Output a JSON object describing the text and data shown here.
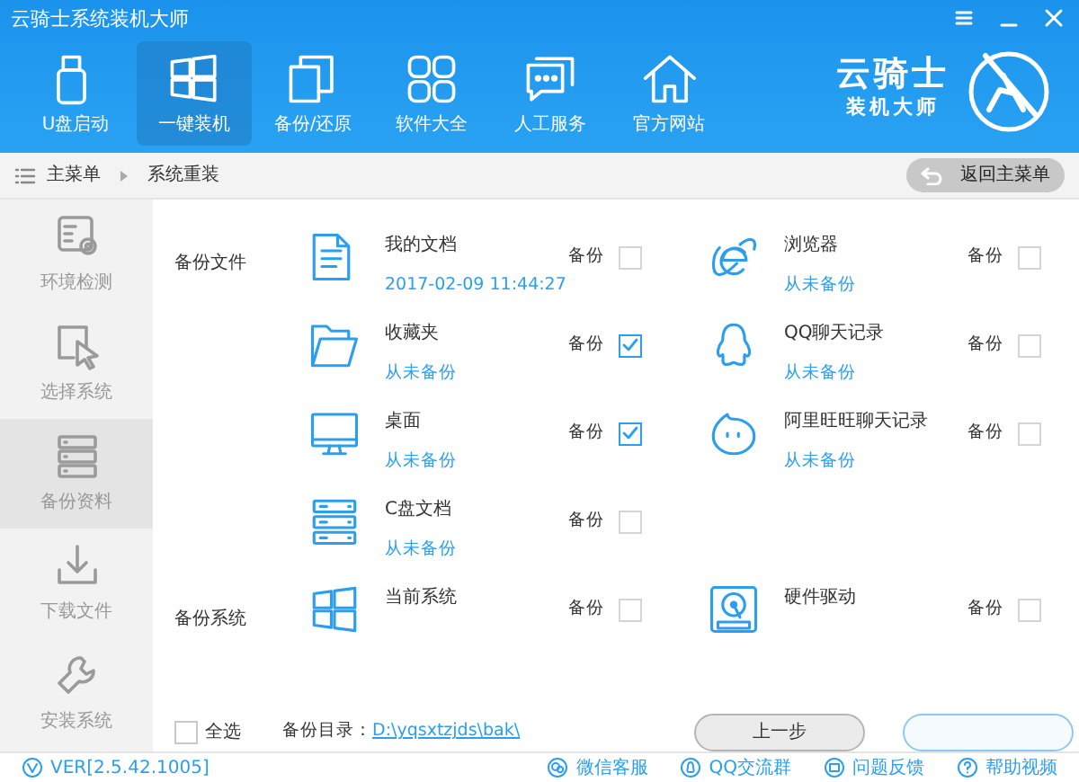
{
  "window": {
    "title": "云骑士系统装机大师"
  },
  "nav": [
    {
      "label": "U盘启动",
      "kind": "usb",
      "selected": false
    },
    {
      "label": "一键装机",
      "kind": "windows",
      "selected": true
    },
    {
      "label": "备份/还原",
      "kind": "copy",
      "selected": false
    },
    {
      "label": "软件大全",
      "kind": "grid",
      "selected": false
    },
    {
      "label": "人工服务",
      "kind": "chat",
      "selected": false
    },
    {
      "label": "官方网站",
      "kind": "home",
      "selected": false
    }
  ],
  "logo": {
    "name": "云骑士",
    "tagline": "装机大师"
  },
  "breadcrumb": [
    "主菜单",
    "系统重装"
  ],
  "back_button": "返回主菜单",
  "sidebar": [
    {
      "label": "环境检测",
      "kind": "gear-box",
      "selected": false
    },
    {
      "label": "选择系统",
      "kind": "pointer",
      "selected": false
    },
    {
      "label": "备份资料",
      "kind": "server",
      "selected": true
    },
    {
      "label": "下载文件",
      "kind": "download",
      "selected": false
    },
    {
      "label": "安装系统",
      "kind": "wrench",
      "selected": false
    }
  ],
  "sections": [
    {
      "label": "备份文件",
      "items": [
        {
          "kind": "document",
          "name": "我的文档",
          "status": "2017-02-09 11:44:27",
          "backup_label": "备份",
          "checked": false
        },
        {
          "kind": "browser",
          "name": "浏览器",
          "status": "从未备份",
          "backup_label": "备份",
          "checked": false
        },
        {
          "kind": "folder",
          "name": "收藏夹",
          "status": "从未备份",
          "backup_label": "备份",
          "checked": true
        },
        {
          "kind": "penguin",
          "name": "QQ聊天记录",
          "status": "从未备份",
          "backup_label": "备份",
          "checked": false
        },
        {
          "kind": "monitor",
          "name": "桌面",
          "status": "从未备份",
          "backup_label": "备份",
          "checked": true
        },
        {
          "kind": "bubble",
          "name": "阿里旺旺聊天记录",
          "status": "从未备份",
          "backup_label": "备份",
          "checked": false
        },
        {
          "kind": "server",
          "name": "C盘文档",
          "status": "从未备份",
          "backup_label": "备份",
          "checked": false
        }
      ]
    },
    {
      "label": "备份系统",
      "items": [
        {
          "kind": "windows",
          "name": "当前系统",
          "backup_label": "备份",
          "checked": false
        },
        {
          "kind": "disk",
          "name": "硬件驱动",
          "backup_label": "备份",
          "checked": false
        }
      ]
    }
  ],
  "select_all": {
    "label": "全选",
    "checked": false
  },
  "backup_dir": {
    "label": "备份目录：",
    "path": "D:\\yqsxtzjds\\bak\\"
  },
  "prev_button": "上一步",
  "version": "VER[2.5.42.1005]",
  "footer_links": [
    {
      "label": "微信客服",
      "kind": "wechat"
    },
    {
      "label": "QQ交流群",
      "kind": "qq"
    },
    {
      "label": "问题反馈",
      "kind": "feedback"
    },
    {
      "label": "帮助视频",
      "kind": "help"
    }
  ]
}
